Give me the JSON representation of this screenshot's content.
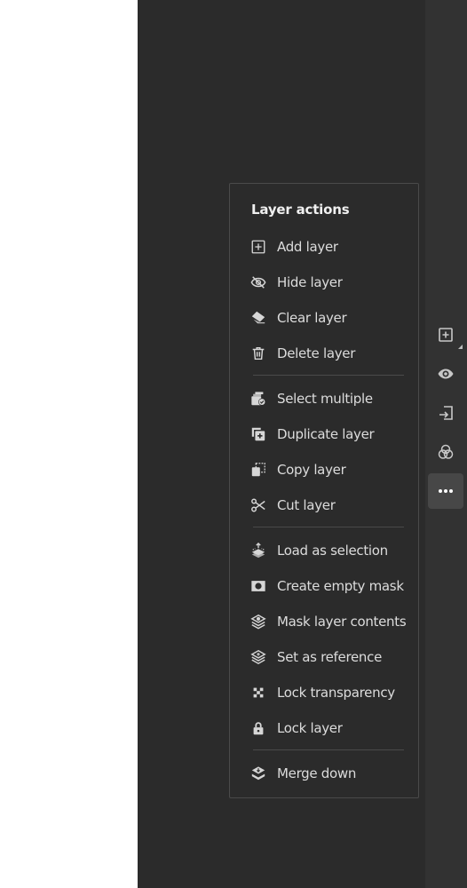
{
  "menu": {
    "title": "Layer actions",
    "items": [
      {
        "label": "Add layer",
        "icon": "add-layer-icon"
      },
      {
        "label": "Hide layer",
        "icon": "hide-icon"
      },
      {
        "label": "Clear layer",
        "icon": "eraser-icon"
      },
      {
        "label": "Delete layer",
        "icon": "trash-icon"
      },
      {
        "label": "Select multiple",
        "icon": "select-multiple-icon"
      },
      {
        "label": "Duplicate layer",
        "icon": "duplicate-icon"
      },
      {
        "label": "Copy layer",
        "icon": "copy-icon"
      },
      {
        "label": "Cut layer",
        "icon": "scissors-icon"
      },
      {
        "label": "Load as selection",
        "icon": "load-selection-icon"
      },
      {
        "label": "Create empty mask",
        "icon": "mask-icon"
      },
      {
        "label": "Mask layer contents",
        "icon": "mask-contents-icon"
      },
      {
        "label": "Set as reference",
        "icon": "reference-icon"
      },
      {
        "label": "Lock transparency",
        "icon": "checker-icon"
      },
      {
        "label": "Lock layer",
        "icon": "lock-icon"
      },
      {
        "label": "Merge down",
        "icon": "merge-down-icon"
      }
    ]
  },
  "rail": {
    "buttons": [
      {
        "icon": "add-layer-icon",
        "active": false
      },
      {
        "icon": "eye-icon",
        "active": false
      },
      {
        "icon": "insert-icon",
        "active": false
      },
      {
        "icon": "blend-modes-icon",
        "active": false
      },
      {
        "icon": "more-icon",
        "active": true
      }
    ]
  },
  "colors": {
    "panel": "#2b2b2b",
    "rail": "#323232",
    "text": "#dcdcdc",
    "active": "#474747"
  }
}
